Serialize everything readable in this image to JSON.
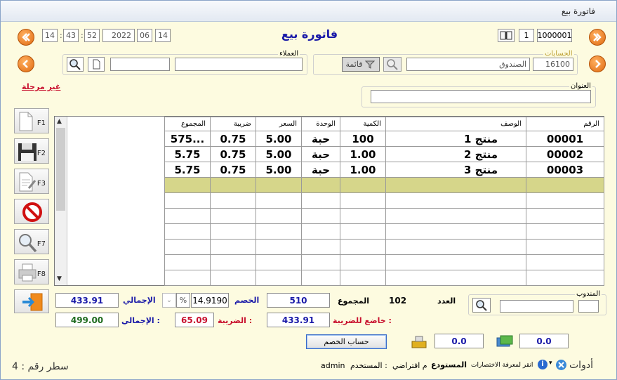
{
  "window": {
    "title": "فاتورة بيع"
  },
  "header": {
    "title": "فاتورة بيع",
    "date": {
      "day": "14",
      "month": "06",
      "year": "2022"
    },
    "time": {
      "hour": "14",
      "minute": "43",
      "second": "52"
    },
    "invoice_number": "1000001",
    "invoice_index": "1"
  },
  "accounts": {
    "label": "الحسابات",
    "code": "16100",
    "name": "الصندوق",
    "list_button": "قائمة"
  },
  "customers": {
    "label": "العملاء"
  },
  "address": {
    "label": "العنوان"
  },
  "status_link": "غير مرحلة",
  "toolbar": {
    "f1": "F1",
    "f2": "F2",
    "f3": "F3",
    "f7": "F7",
    "f8": "F8"
  },
  "grid": {
    "columns": [
      "الرقم",
      "الوصف",
      "الكمية",
      "الوحدة",
      "السعر",
      "ضريبة",
      "المجموع"
    ],
    "rows": [
      [
        "00001",
        "منتج 1",
        "100",
        "حبة",
        "5.00",
        "0.75",
        "575..."
      ],
      [
        "00002",
        "منتج 2",
        "1.00",
        "حبة",
        "5.00",
        "0.75",
        "5.75"
      ],
      [
        "00003",
        "منتج 3",
        "1.00",
        "حبة",
        "5.00",
        "0.75",
        "5.75"
      ]
    ]
  },
  "rep": {
    "label": "المندوب"
  },
  "totals": {
    "count_label": "العدد",
    "count": "102",
    "sum_label": "المجموع",
    "sum": "510",
    "discount_label": "الخصم",
    "discount": "14.9190",
    "discount_unit": "%",
    "total_label": "الإجمالي",
    "total": "433.91",
    "taxable_label": "خاضع للضريبة :",
    "taxable": "433.91",
    "tax_label": "الضريبة :",
    "tax": "65.09",
    "grand_label": "الإجمالي :",
    "grand": "499.00",
    "calc_discount_button": "حساب الخصم",
    "cash": "0.0",
    "card": "0.0"
  },
  "status": {
    "tools": "أدوات",
    "shortcuts_hint": "انقر لمعرفة الاختصارات",
    "warehouse_label": "المستودع",
    "warehouse_value": "م افتراضي",
    "user_label": "المستخدم :",
    "user_value": "admin",
    "line_label": "سطر رقم : 4"
  },
  "colors": {
    "accent_orange": "#e06a10",
    "blue_value": "#1a1aa8",
    "red_value": "#c8102e",
    "green_value": "#1e6b1e",
    "title_blue": "#1a1aa8"
  }
}
